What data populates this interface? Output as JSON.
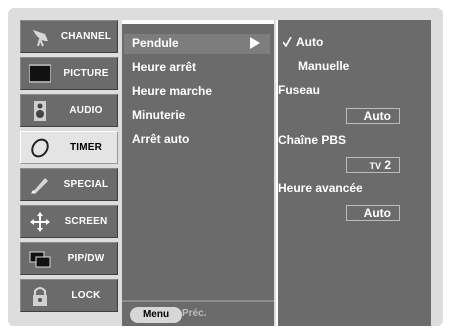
{
  "sidebar": {
    "items": [
      {
        "label": "CHANNEL",
        "icon": "satellite-dish-icon"
      },
      {
        "label": "PICTURE",
        "icon": "monitor-icon"
      },
      {
        "label": "AUDIO",
        "icon": "speaker-icon"
      },
      {
        "label": "TIMER",
        "icon": "clock-icon"
      },
      {
        "label": "SPECIAL",
        "icon": "pen-icon"
      },
      {
        "label": "SCREEN",
        "icon": "crosshair-arrows-icon"
      },
      {
        "label": "PIP/DW",
        "icon": "overlapping-windows-icon"
      },
      {
        "label": "LOCK",
        "icon": "padlock-icon"
      }
    ],
    "active_index": 3
  },
  "menu": {
    "items": [
      "Pendule",
      "Heure arrêt",
      "Heure marche",
      "Minuterie",
      "Arrêt auto"
    ],
    "selected_index": 0
  },
  "submenu": {
    "options": [
      "Auto",
      "Manuelle"
    ],
    "selected_option": "Auto",
    "fuseau_label": "Fuseau",
    "fuseau_value": "Auto",
    "pbs_label": "Chaîne PBS",
    "pbs_value_prefix": "TV",
    "pbs_value_number": "2",
    "dst_label": "Heure avancée",
    "dst_value": "Auto"
  },
  "footer": {
    "menu_button": "Menu",
    "prev_label": "Préc."
  },
  "colors": {
    "panel": "#6b6b6b",
    "frame": "#dddddd",
    "active_tab": "#e4e4e4"
  }
}
